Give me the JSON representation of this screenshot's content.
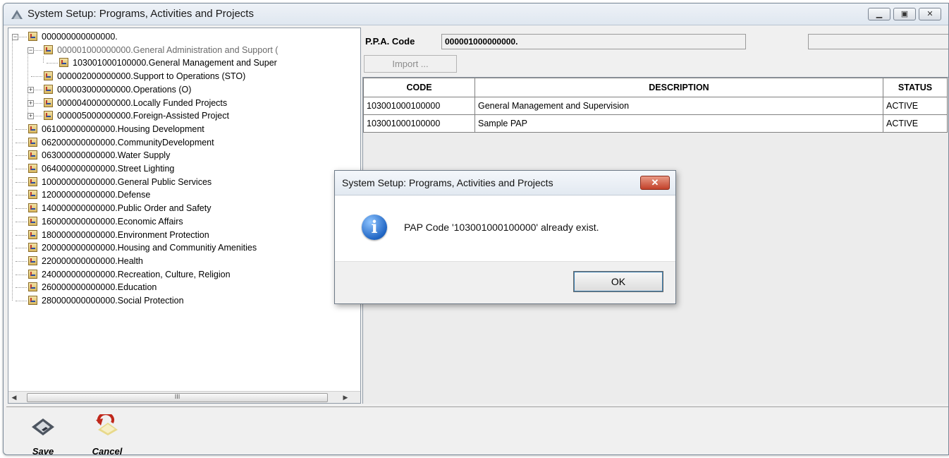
{
  "window": {
    "title": "System Setup:  Programs, Activities and Projects",
    "controls": [
      "minimize-icon",
      "maximize-icon",
      "close-icon"
    ]
  },
  "tree": {
    "items": [
      {
        "label": "000000000000000.",
        "level": 0,
        "expander": "minus"
      },
      {
        "label": "000001000000000.General Administration and Support (",
        "level": 1,
        "expander": "minus",
        "selected": true
      },
      {
        "label": "103001000100000.General  Management and Super",
        "level": 2,
        "expander": ""
      },
      {
        "label": "000002000000000.Support to Operations (STO)",
        "level": 1,
        "expander": ""
      },
      {
        "label": "000003000000000.Operations (O)",
        "level": 1,
        "expander": "plus"
      },
      {
        "label": "000004000000000.Locally Funded Projects",
        "level": 1,
        "expander": "plus"
      },
      {
        "label": "000005000000000.Foreign-Assisted Project",
        "level": 1,
        "expander": "plus"
      },
      {
        "label": "061000000000000.Housing Development",
        "level": 0,
        "expander": ""
      },
      {
        "label": "062000000000000.CommunityDevelopment",
        "level": 0,
        "expander": ""
      },
      {
        "label": "063000000000000.Water Supply",
        "level": 0,
        "expander": ""
      },
      {
        "label": "064000000000000.Street Lighting",
        "level": 0,
        "expander": ""
      },
      {
        "label": "100000000000000.General Public Services",
        "level": 0,
        "expander": ""
      },
      {
        "label": "120000000000000.Defense",
        "level": 0,
        "expander": ""
      },
      {
        "label": "140000000000000.Public Order and Safety",
        "level": 0,
        "expander": ""
      },
      {
        "label": "160000000000000.Economic Affairs",
        "level": 0,
        "expander": ""
      },
      {
        "label": "180000000000000.Environment Protection",
        "level": 0,
        "expander": ""
      },
      {
        "label": "200000000000000.Housing and Communitiy Amenities",
        "level": 0,
        "expander": ""
      },
      {
        "label": "220000000000000.Health",
        "level": 0,
        "expander": ""
      },
      {
        "label": "240000000000000.Recreation, Culture, Religion",
        "level": 0,
        "expander": ""
      },
      {
        "label": "260000000000000.Education",
        "level": 0,
        "expander": ""
      },
      {
        "label": "280000000000000.Social Protection",
        "level": 0,
        "expander": ""
      }
    ],
    "scroll_thumb_glyph": "III"
  },
  "form": {
    "ppa_code_label": "P.P.A. Code",
    "ppa_code_value": "000001000000000.",
    "import_label": "Import ..."
  },
  "grid": {
    "columns": [
      "CODE",
      "DESCRIPTION",
      "STATUS"
    ],
    "rows": [
      [
        "103001000100000",
        "General  Management and Supervision",
        "ACTIVE"
      ],
      [
        "103001000100000",
        "Sample PAP",
        "ACTIVE"
      ]
    ]
  },
  "toolbar": {
    "save_label": "Save",
    "cancel_label": "Cancel"
  },
  "dialog": {
    "title": "System Setup:  Programs, Activities and Projects",
    "close_glyph": "✕",
    "icon": "info-icon",
    "message": "PAP Code '103001000100000' already exist.",
    "ok_label": "OK"
  }
}
